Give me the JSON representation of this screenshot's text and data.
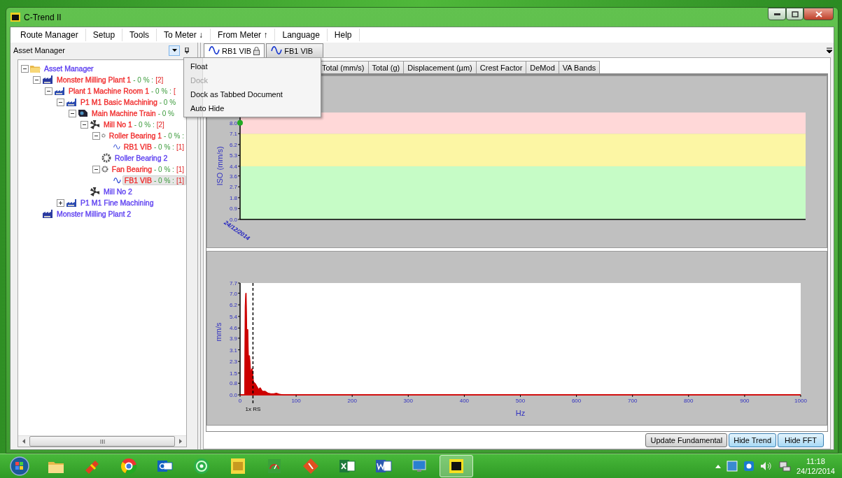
{
  "window": {
    "title": "C-Trend II"
  },
  "menu": [
    {
      "label": "Route Manager"
    },
    {
      "label": "Setup"
    },
    {
      "label": "Tools"
    },
    {
      "label": "To Meter ↓"
    },
    {
      "label": "From Meter ↑"
    },
    {
      "label": "Language"
    },
    {
      "label": "Help"
    }
  ],
  "asset_panel": {
    "title": "Asset Manager",
    "tree": [
      {
        "name": "Asset Manager",
        "kind": "folder",
        "color": "#5a3cf0",
        "expanded": true,
        "selected": false,
        "children": [
          {
            "name": "Monster Milling Plant 1",
            "kind": "plant",
            "color": "#f02a2a",
            "info": "- 0 % :",
            "count": "[2]",
            "expanded": true,
            "selected": false,
            "children": [
              {
                "name": "Plant 1 Machine Room 1",
                "kind": "area",
                "color": "#f02a2a",
                "info": "- 0 % :",
                "count": "[",
                "expanded": true,
                "selected": false,
                "children": [
                  {
                    "name": "P1 M1 Basic Machining",
                    "kind": "area",
                    "color": "#f02a2a",
                    "info": "- 0 %",
                    "expanded": true,
                    "selected": false,
                    "children": [
                      {
                        "name": "Main Machine Train",
                        "kind": "train",
                        "color": "#f02a2a",
                        "info": "- 0 %",
                        "expanded": true,
                        "selected": false,
                        "children": [
                          {
                            "name": "Mill No 1",
                            "kind": "machine",
                            "color": "#f02a2a",
                            "info": "- 0 % :",
                            "count": "[2]",
                            "expanded": true,
                            "selected": false,
                            "children": [
                              {
                                "name": "Roller Bearing 1",
                                "kind": "bearing",
                                "color": "#f02a2a",
                                "info": "- 0 % :",
                                "expanded": true,
                                "selected": false,
                                "children": [
                                  {
                                    "name": "RB1 VIB",
                                    "kind": "point",
                                    "color": "#f02a2a",
                                    "info": "- 0 % :",
                                    "count": "[1]",
                                    "selected": false
                                  }
                                ]
                              },
                              {
                                "name": "Roller Bearing 2",
                                "kind": "bearing",
                                "color": "#5a3cf0",
                                "selected": false
                              },
                              {
                                "name": "Fan Bearing",
                                "kind": "bearing",
                                "color": "#f02a2a",
                                "info": "- 0 % :",
                                "count": "[1]",
                                "expanded": true,
                                "selected": false,
                                "children": [
                                  {
                                    "name": "FB1 VIB",
                                    "kind": "point",
                                    "color": "#f02a2a",
                                    "info": "- 0 % :",
                                    "count": "[1]",
                                    "selected": true
                                  }
                                ]
                              }
                            ]
                          },
                          {
                            "name": "Mill No 2",
                            "kind": "machine",
                            "color": "#5a3cf0",
                            "selected": false
                          }
                        ]
                      }
                    ]
                  },
                  {
                    "name": "P1 M1 Fine Machining",
                    "kind": "area",
                    "color": "#5a3cf0",
                    "expanded": false,
                    "selected": false
                  }
                ]
              }
            ]
          },
          {
            "name": "Monster Milling Plant 2",
            "kind": "plant",
            "color": "#5a3cf0",
            "selected": false
          }
        ]
      }
    ]
  },
  "panel_menu": [
    {
      "label": "Float",
      "disabled": false
    },
    {
      "label": "Dock",
      "disabled": true
    },
    {
      "label": "Dock as Tabbed Document",
      "disabled": false
    },
    {
      "label": "Auto Hide",
      "disabled": false
    }
  ],
  "documents": [
    {
      "label": "RB1 VIB",
      "selected": true,
      "locked": true
    },
    {
      "label": "FB1 VIB",
      "selected": false,
      "locked": false
    }
  ],
  "view_tabs": [
    {
      "label": "Total (mm/s)",
      "selected": false
    },
    {
      "label": "Total (g)",
      "selected": false
    },
    {
      "label": "Displacement (µm)",
      "selected": false
    },
    {
      "label": "Crest Factor",
      "selected": false
    },
    {
      "label": "DeMod",
      "selected": false
    },
    {
      "label": "VA Bands",
      "selected": false
    }
  ],
  "trend_chart": {
    "chart_data": {
      "type": "scatter",
      "ylabel": "ISO (mm/s)",
      "categories": [
        "24/12/2014"
      ],
      "series": [
        {
          "color": "#22aa22",
          "values": [
            8.0
          ]
        }
      ],
      "ylim": [
        0,
        8.85
      ],
      "yticks": [
        {
          "value": 0,
          "label": "0.0"
        },
        {
          "value": 0.9,
          "label": "0.9"
        },
        {
          "value": 1.8,
          "label": "1.8"
        },
        {
          "value": 2.7,
          "label": "2.7"
        },
        {
          "value": 3.6,
          "label": "3.6"
        },
        {
          "value": 4.4,
          "label": "4.4"
        },
        {
          "value": 5.3,
          "label": "5.3"
        },
        {
          "value": 6.2,
          "label": "6.2"
        },
        {
          "value": 7.1,
          "label": "7.1"
        },
        {
          "value": 8.0,
          "label": "8.0"
        }
      ],
      "bands": [
        {
          "axis": "y",
          "from": 0,
          "to": 4.4,
          "color": "#c6fcc6"
        },
        {
          "axis": "y",
          "from": 4.4,
          "to": 7.1,
          "color": "#fcf6a4"
        },
        {
          "axis": "y",
          "from": 7.1,
          "to": 8.85,
          "color": "#ffd8d8"
        }
      ]
    }
  },
  "fft_chart": {
    "chart_data": {
      "type": "area",
      "xlabel": "Hz",
      "ylabel": "mm/s",
      "x": [
        0,
        8,
        9,
        10,
        11,
        12,
        14,
        15,
        17,
        19,
        21,
        22,
        24,
        27,
        30,
        33,
        36,
        40,
        45,
        50,
        55,
        60,
        65,
        70,
        78,
        1000
      ],
      "series": [
        {
          "color": "#cc0000",
          "values": [
            0,
            0,
            6.1,
            7.0,
            7.0,
            4.5,
            4.5,
            2.7,
            2.7,
            1.6,
            1.8,
            1.8,
            0.9,
            0.8,
            0.6,
            0.4,
            0.5,
            0.25,
            0.25,
            0.12,
            0.08,
            0.08,
            0.12,
            0.05,
            0,
            0
          ]
        }
      ],
      "xlim": [
        0,
        1000
      ],
      "ylim": [
        0,
        7.7
      ],
      "xticks": [
        0,
        100,
        200,
        300,
        400,
        500,
        600,
        700,
        800,
        900,
        1000
      ],
      "yticks": [
        {
          "value": 0,
          "label": "0.0"
        },
        {
          "value": 0.8,
          "label": "0.8"
        },
        {
          "value": 1.5,
          "label": "1.5"
        },
        {
          "value": 2.3,
          "label": "2.3"
        },
        {
          "value": 3.1,
          "label": "3.1"
        },
        {
          "value": 3.9,
          "label": "3.9"
        },
        {
          "value": 4.6,
          "label": "4.6"
        },
        {
          "value": 5.4,
          "label": "5.4"
        },
        {
          "value": 6.2,
          "label": "6.2"
        },
        {
          "value": 7.0,
          "label": "7.0"
        },
        {
          "value": 7.7,
          "label": "7.7"
        }
      ],
      "ref_lines": [
        {
          "value": 23,
          "axis": "x",
          "label": "1x RS"
        }
      ]
    }
  },
  "buttons": [
    {
      "label": "Update Fundamental",
      "highlighted": false
    },
    {
      "label": "Hide Trend",
      "highlighted": true
    },
    {
      "label": "Hide FFT",
      "highlighted": true
    }
  ],
  "taskbar": {
    "apps": [
      {
        "kind": "folder",
        "active": false
      },
      {
        "kind": "tool",
        "active": false
      },
      {
        "kind": "browser",
        "active": false
      },
      {
        "kind": "mail",
        "active": false
      },
      {
        "kind": "disc",
        "active": false
      },
      {
        "kind": "tile",
        "active": false
      },
      {
        "kind": "gauge",
        "active": false
      },
      {
        "kind": "diamond",
        "active": false
      },
      {
        "kind": "sheet",
        "active": false
      },
      {
        "kind": "doc",
        "active": false
      },
      {
        "kind": "screen",
        "active": false
      },
      {
        "kind": "logo",
        "active": true
      }
    ],
    "clock": {
      "time": "11:18",
      "date": "24/12/2014"
    }
  }
}
